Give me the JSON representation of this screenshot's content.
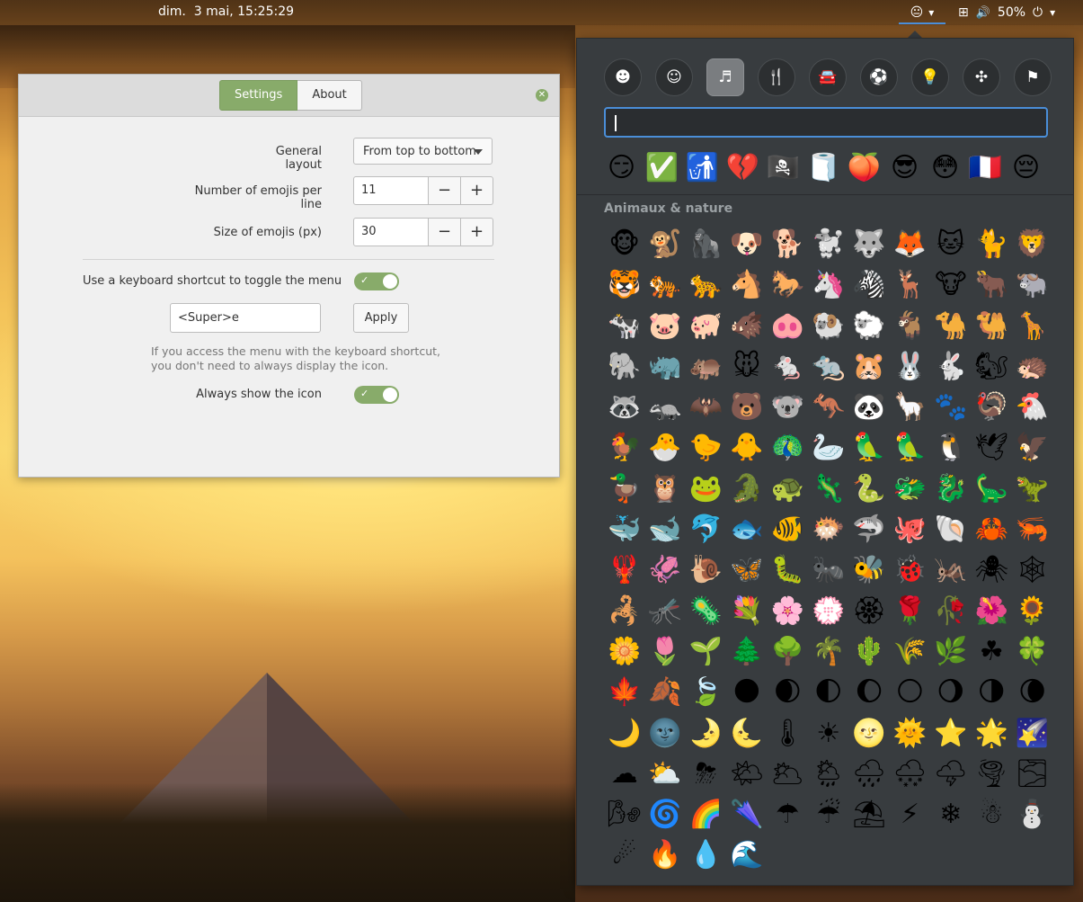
{
  "topbar": {
    "clock": "dim.  3 mai, 15:25:29",
    "tray_emoji_icon": "😐",
    "tray_emoji_arrow": "▾",
    "network_icon": "⊞",
    "volume_icon": "🔊",
    "battery_label": "50%",
    "power_icon": "⏻",
    "power_arrow": "▾"
  },
  "settings": {
    "tabs": [
      {
        "label": "Settings"
      },
      {
        "label": "About"
      }
    ],
    "close_icon": "✕",
    "general_layout_label": "General layout",
    "general_layout_value": "From top to bottom",
    "emojis_per_line_label": "Number of emojis per line",
    "emojis_per_line_value": "11",
    "emoji_size_label": "Size of emojis (px)",
    "emoji_size_value": "30",
    "minus": "−",
    "plus": "+",
    "shortcut_label": "Use a keyboard shortcut to toggle the menu",
    "shortcut_value": "<Super>e",
    "apply_label": "Apply",
    "hint_line1": "If you access the menu with the keyboard shortcut,",
    "hint_line2": "you don't need to always display the icon.",
    "always_show_label": "Always show the icon",
    "check": "✓"
  },
  "emoji_menu": {
    "categories": [
      {
        "name": "smileys",
        "icon": "☻"
      },
      {
        "name": "people",
        "icon": "☺"
      },
      {
        "name": "nature",
        "icon": "♬"
      },
      {
        "name": "food",
        "icon": "🍴"
      },
      {
        "name": "travel",
        "icon": "🚘"
      },
      {
        "name": "activities",
        "icon": "⚽"
      },
      {
        "name": "objects",
        "icon": "💡"
      },
      {
        "name": "symbols",
        "icon": "✣"
      },
      {
        "name": "flags",
        "icon": "⚑"
      }
    ],
    "recent": [
      "😏",
      "✅",
      "🚮",
      "💔",
      "🏴‍☠️",
      "🧻",
      "🍑",
      "😎",
      "😳",
      "🇫🇷",
      "😔"
    ],
    "section_title": "Animaux & nature",
    "emojis": [
      "🐵",
      "🐒",
      "🦍",
      "🐶",
      "🐕",
      "🐩",
      "🐺",
      "🦊",
      "🐱",
      "🐈",
      "🦁",
      "🐯",
      "🐅",
      "🐆",
      "🐴",
      "🐎",
      "🦄",
      "🦓",
      "🦌",
      "🐮",
      "🐂",
      "🐃",
      "🐄",
      "🐷",
      "🐖",
      "🐗",
      "🐽",
      "🐏",
      "🐑",
      "🐐",
      "🐪",
      "🐫",
      "🦒",
      "🐘",
      "🦏",
      "🦛",
      "🐭",
      "🐁",
      "🐀",
      "🐹",
      "🐰",
      "🐇",
      "🐿",
      "🦔",
      "🦝",
      "🦡",
      "🦇",
      "🐻",
      "🐨",
      "🦘",
      "🐼",
      "🦙",
      "🐾",
      "🦃",
      "🐔",
      "🐓",
      "🐣",
      "🐤",
      "🐥",
      "🦚",
      "🦢",
      "🦜",
      "🦜",
      "🐧",
      "🕊",
      "🦅",
      "🦆",
      "🦉",
      "🐸",
      "🐊",
      "🐢",
      "🦎",
      "🐍",
      "🐲",
      "🐉",
      "🦕",
      "🦖",
      "🐳",
      "🐋",
      "🐬",
      "🐟",
      "🐠",
      "🐡",
      "🦈",
      "🐙",
      "🐚",
      "🦀",
      "🦐",
      "🦞",
      "🦑",
      "🐌",
      "🦋",
      "🐛",
      "🐜",
      "🐝",
      "🐞",
      "🦗",
      "🕷",
      "🕸",
      "🦂",
      "🦟",
      "🦠",
      "💐",
      "🌸",
      "💮",
      "🏵",
      "🌹",
      "🥀",
      "🌺",
      "🌻",
      "🌼",
      "🌷",
      "🌱",
      "🌲",
      "🌳",
      "🌴",
      "🌵",
      "🌾",
      "🌿",
      "☘",
      "🍀",
      "🍁",
      "🍂",
      "🍃",
      "🌑",
      "🌒",
      "🌓",
      "🌔",
      "🌕",
      "🌖",
      "🌗",
      "🌘",
      "🌙",
      "🌚",
      "🌛",
      "🌜",
      "🌡",
      "☀",
      "🌝",
      "🌞",
      "⭐",
      "🌟",
      "🌠",
      "☁",
      "⛅",
      "⛈",
      "🌤",
      "🌥",
      "🌦",
      "🌧",
      "🌨",
      "🌩",
      "🌪",
      "🌫",
      "🌬",
      "🌀",
      "🌈",
      "🌂",
      "☂",
      "☔",
      "⛱",
      "⚡",
      "❄",
      "☃",
      "⛄",
      "☄",
      "🔥",
      "💧",
      "🌊"
    ]
  }
}
